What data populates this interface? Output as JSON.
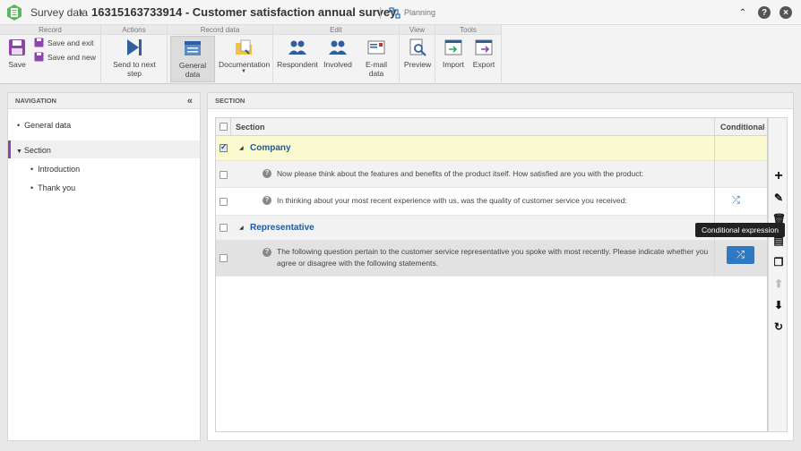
{
  "titlebar": {
    "breadcrumb": "Survey data",
    "record_title": "16315163733914 - Customer satisfaction annual survey",
    "planning": "Planning"
  },
  "ribbon": {
    "groups": {
      "record": "Record",
      "actions": "Actions",
      "record_data": "Record data",
      "edit": "Edit",
      "view": "View",
      "tools": "Tools"
    },
    "buttons": {
      "save": "Save",
      "save_exit": "Save and exit",
      "save_new": "Save and new",
      "send_next": "Send to next step",
      "general_data": "General data",
      "documentation": "Documentation",
      "respondent": "Respondent",
      "involved": "Involved",
      "email_data": "E-mail data",
      "preview": "Preview",
      "import": "Import",
      "export": "Export"
    }
  },
  "navigation": {
    "title": "NAVIGATION",
    "items": [
      "General data",
      "Section",
      "Introduction",
      "Thank you"
    ]
  },
  "section": {
    "title": "SECTION",
    "columns": [
      "Section",
      "Conditional"
    ],
    "rows": [
      {
        "type": "group",
        "label": "Company",
        "checked": true
      },
      {
        "type": "question",
        "text": "Now please think about the features and benefits of the product itself. How satisfied are you with the product:"
      },
      {
        "type": "question",
        "text": "In thinking about your most recent experience with us, was the quality of customer service you received:"
      },
      {
        "type": "group",
        "label": "Representative"
      },
      {
        "type": "question",
        "text_line1": "The following question pertain to the customer service representative you spoke with most recently. Please indicate whether you",
        "text_line2": "agree or disagree with the following statements."
      }
    ],
    "tooltip": "Conditional expression"
  },
  "colors": {
    "accent": "#2f78c4",
    "group_highlight": "#fbf9d0",
    "nav_selected_bar": "#8e44ad"
  }
}
